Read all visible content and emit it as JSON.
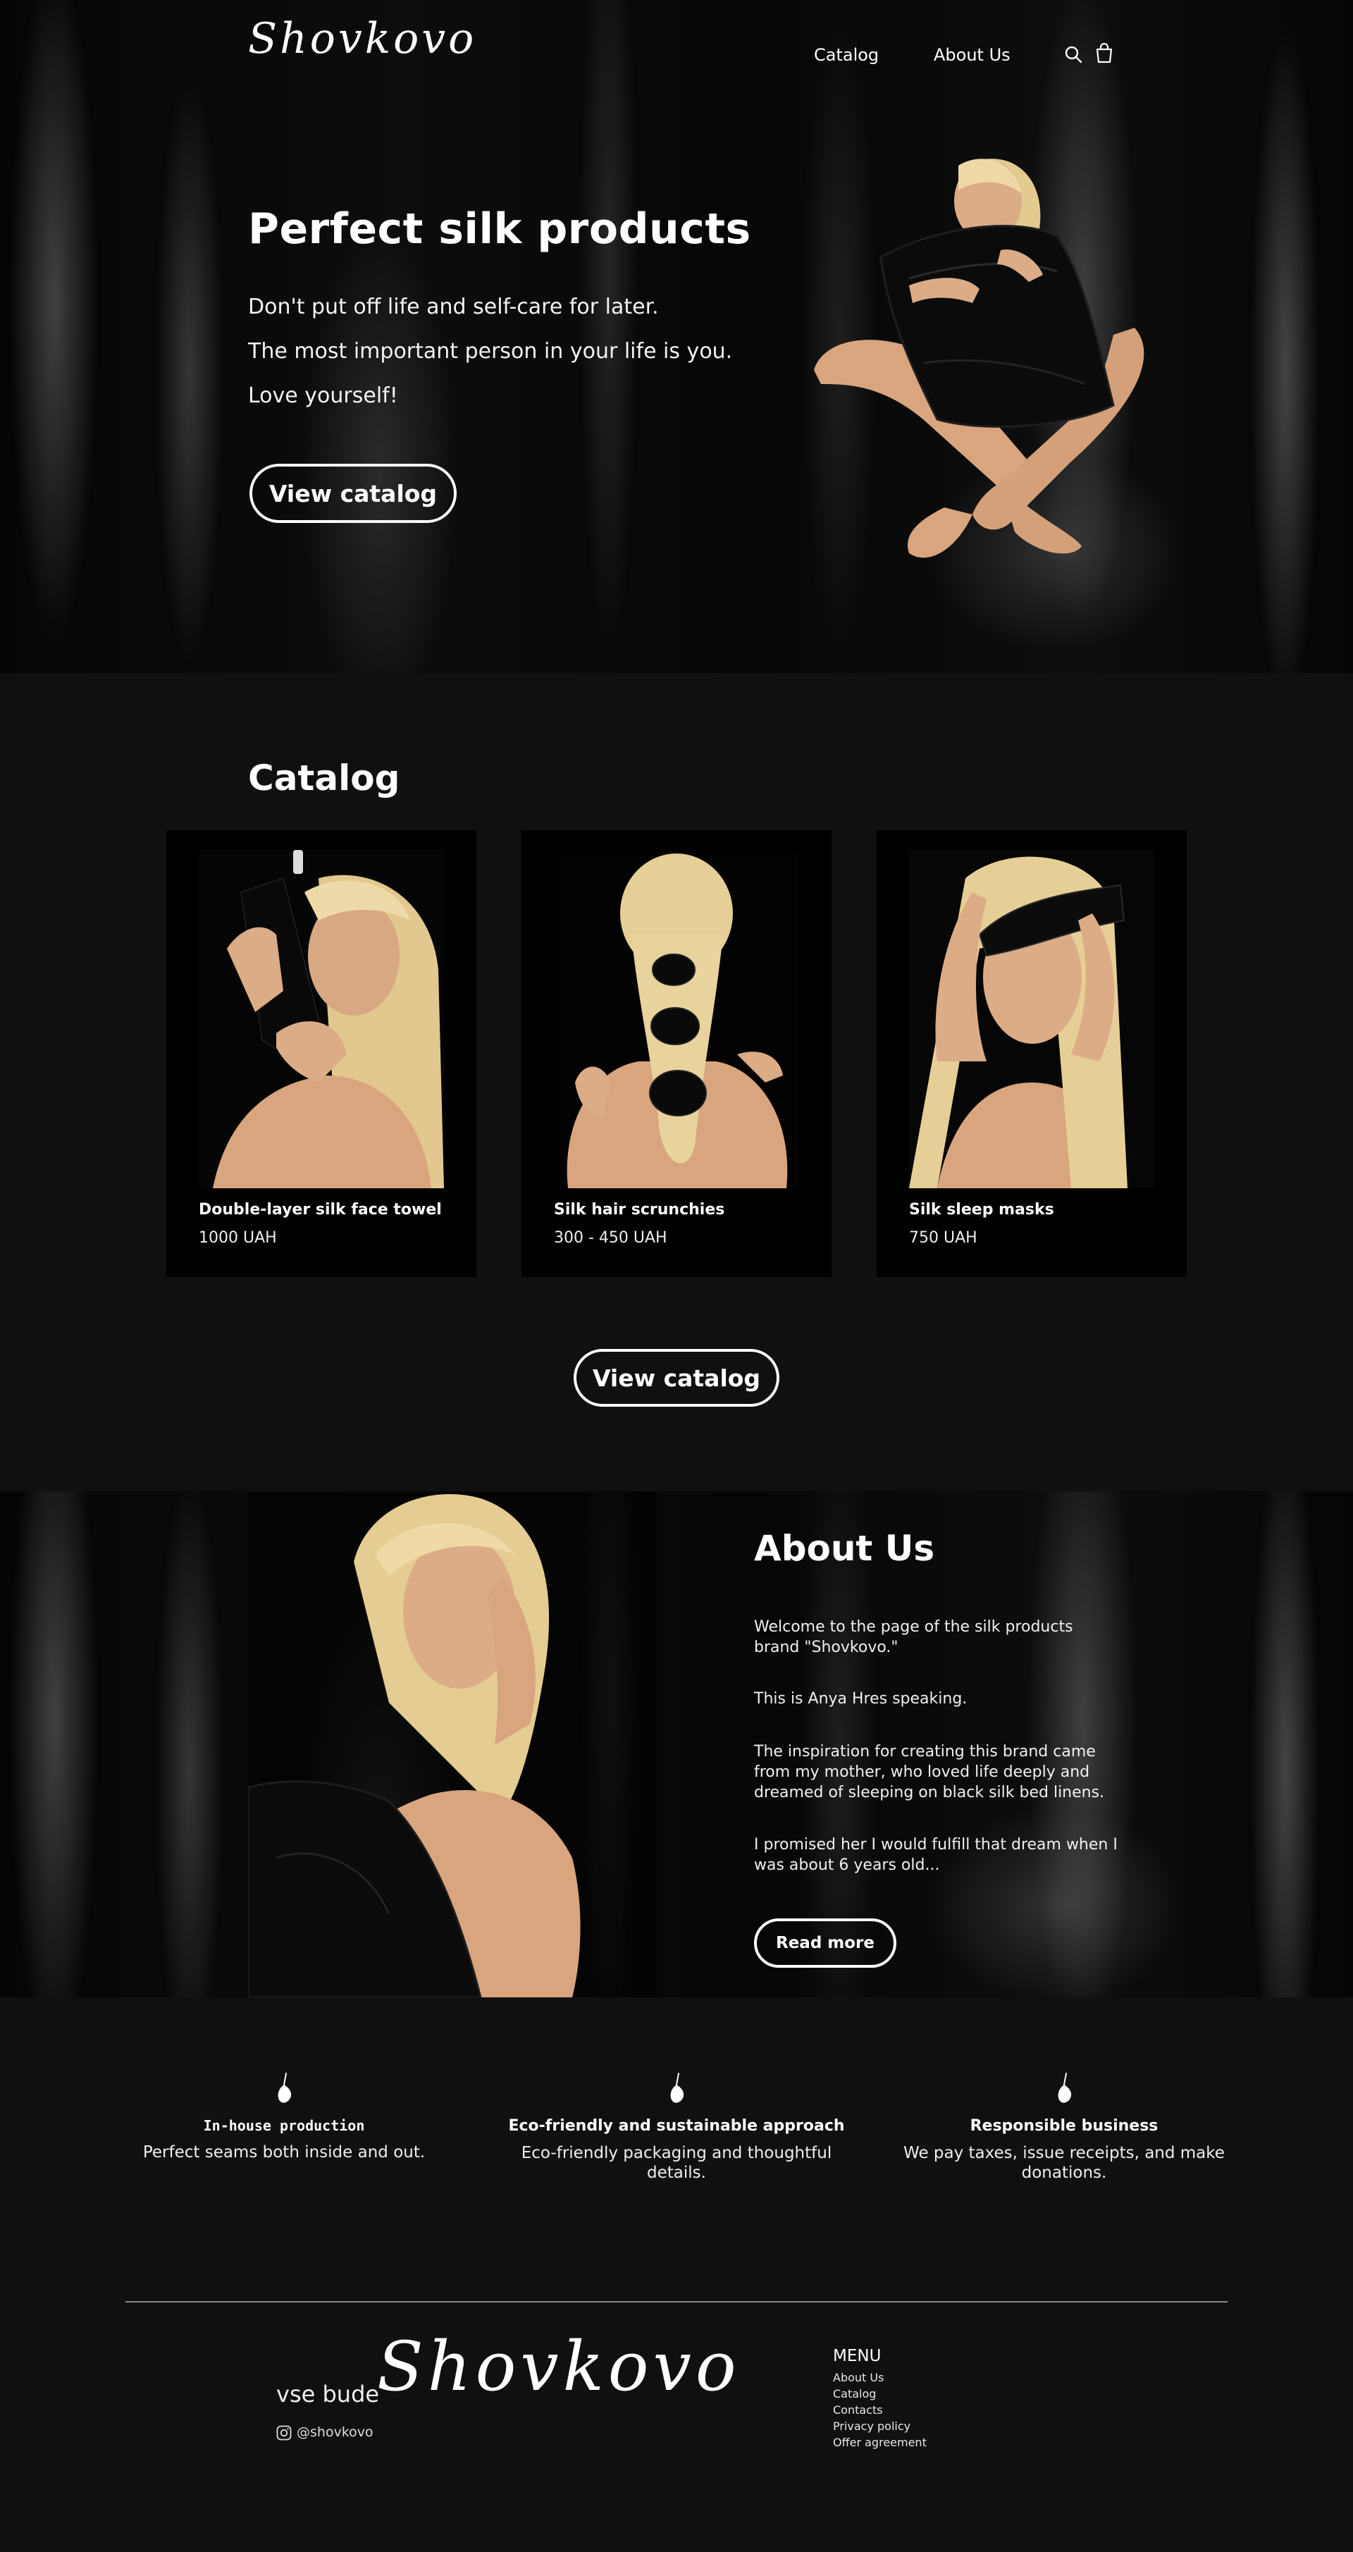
{
  "header": {
    "logo": "Shovkovo",
    "nav": [
      "Catalog",
      "About Us"
    ],
    "icons": [
      "search-icon",
      "cart-icon"
    ]
  },
  "hero": {
    "title": "Perfect silk products",
    "lines": [
      "Don't put off life and self-care for later.",
      "The most important person in your life is you.",
      "Love yourself!"
    ],
    "button": "View catalog"
  },
  "catalog": {
    "title": "Catalog",
    "items": [
      {
        "name": "Double-layer silk face towel",
        "price": "1000 UAH"
      },
      {
        "name": "Silk hair scrunchies",
        "price": "300 - 450 UAH"
      },
      {
        "name": "Silk sleep masks",
        "price": "750 UAH"
      }
    ],
    "button": "View catalog"
  },
  "about": {
    "title": "About Us",
    "paragraphs": [
      "Welcome to the page of the silk products brand \"Shovkovo.\"",
      "This is Anya Hres speaking.",
      "The inspiration for creating this brand came from my mother, who loved life deeply and dreamed of sleeping on black silk bed linens.",
      "I promised her I would fulfill that dream when I was about 6 years old..."
    ],
    "button": "Read more"
  },
  "features": [
    {
      "title": "In-house production",
      "desc": "Perfect seams both inside and out."
    },
    {
      "title": "Eco-friendly and sustainable approach",
      "desc": "Eco-friendly packaging and thoughtful details."
    },
    {
      "title": "Responsible business",
      "desc": "We pay taxes, issue receipts, and make donations."
    }
  ],
  "footer": {
    "tagline": "vse bude",
    "logo": "Shovkovo",
    "instagram": "@shovkovo",
    "menu_title": "MENU",
    "menu": [
      "About Us",
      "Catalog",
      "Contacts",
      "Privacy policy",
      "Offer agreement"
    ]
  },
  "colors": {
    "background": "#101010",
    "card": "#000000",
    "text": "#ffffff",
    "skin": "#d9a57e",
    "hair": "#e6cf96"
  }
}
